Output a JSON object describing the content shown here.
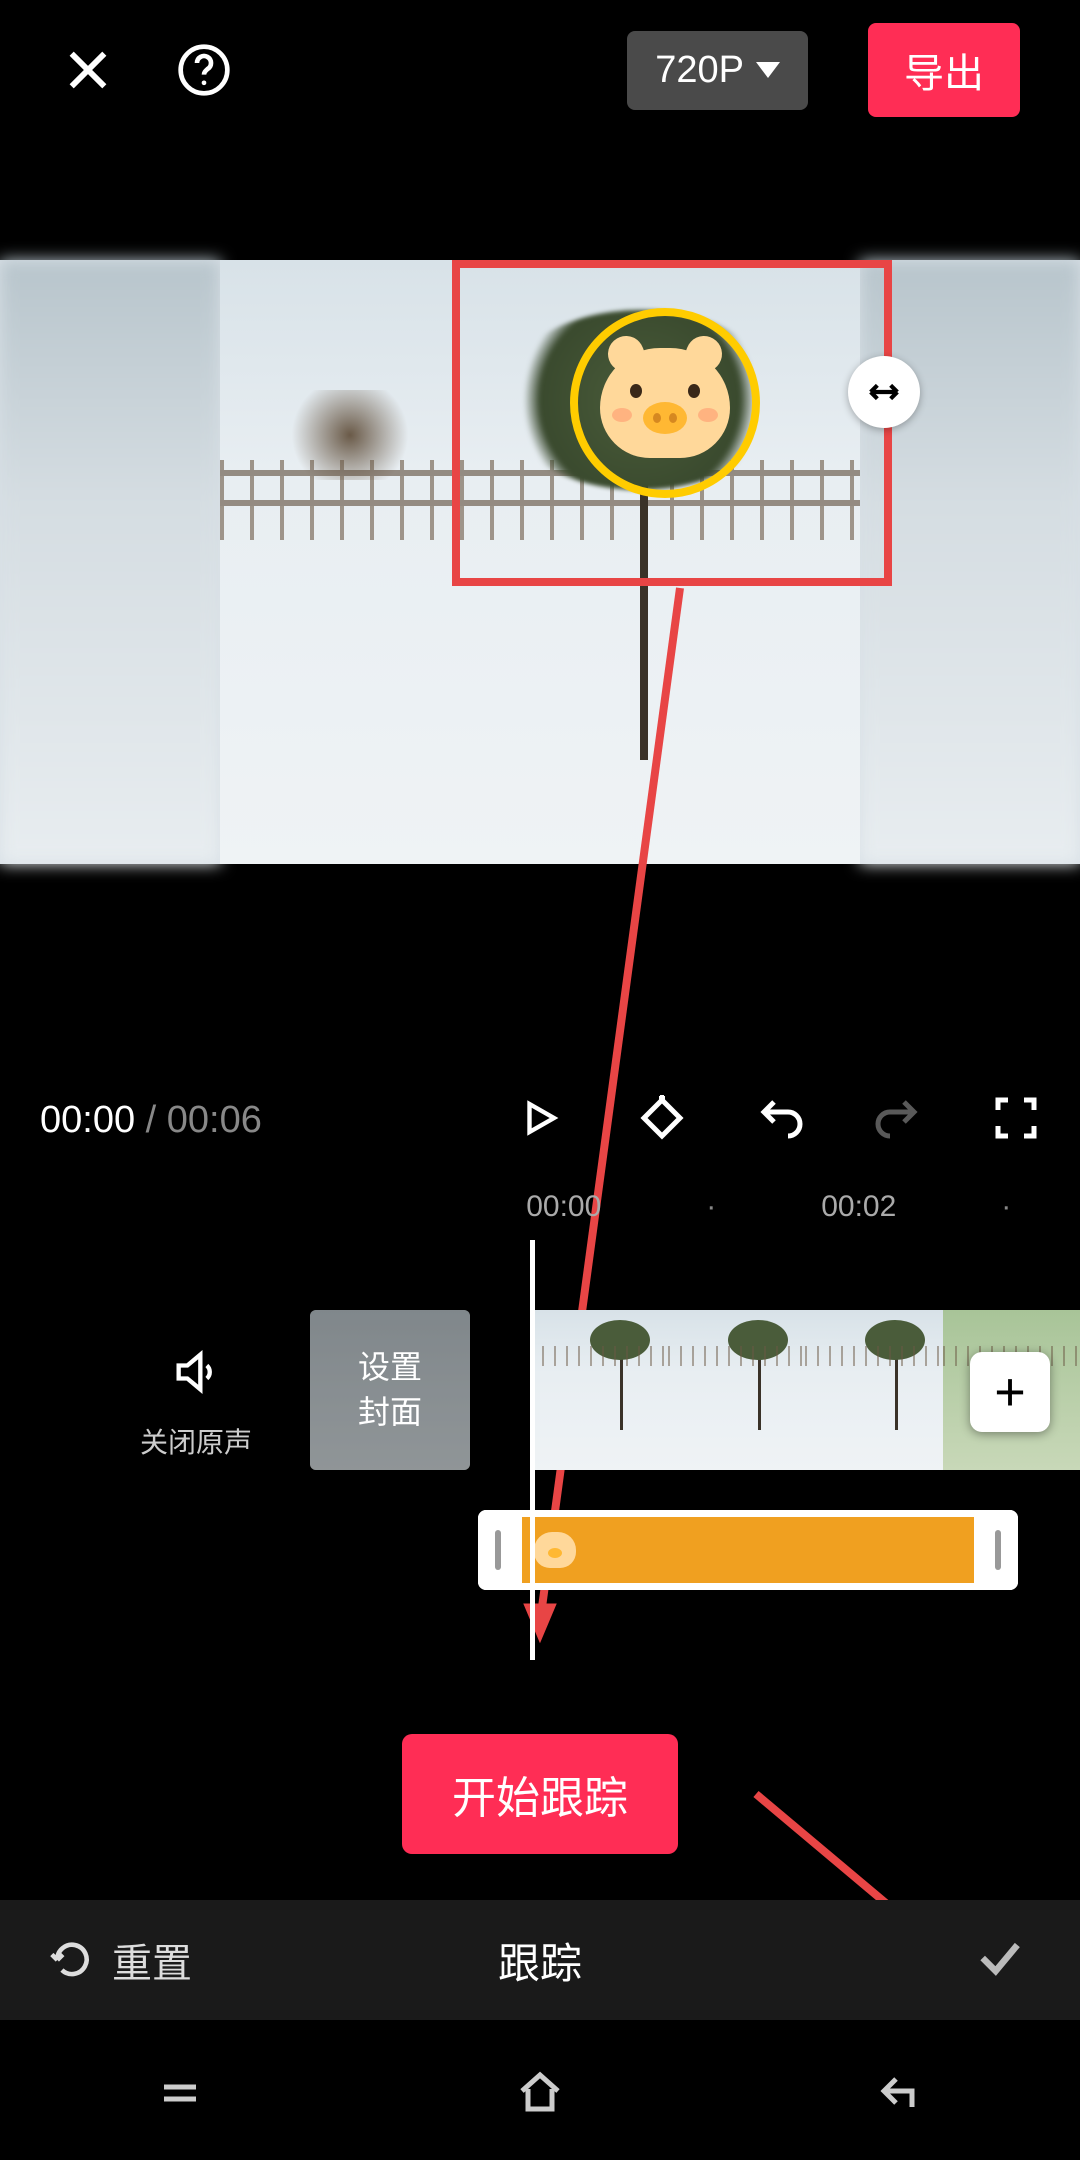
{
  "top": {
    "resolution": "720P",
    "export_label": "导出"
  },
  "playback": {
    "current_time": "00:00",
    "total_time": "00:06"
  },
  "ruler": {
    "marks": [
      "00:00",
      "00:02"
    ]
  },
  "timeline": {
    "mute_label": "关闭原声",
    "cover_label_1": "设置",
    "cover_label_2": "封面"
  },
  "tracking": {
    "start_button": "开始跟踪",
    "reset_label": "重置",
    "title": "跟踪"
  }
}
